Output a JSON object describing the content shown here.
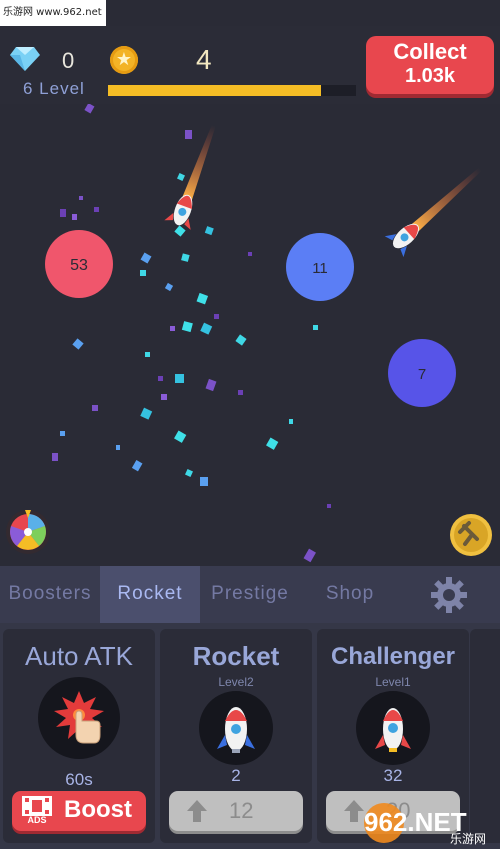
{
  "watermark_top": "乐游网 www.962.net",
  "hud": {
    "gems": "0",
    "coins": "4",
    "coin_symbol": "★",
    "level": "6 Level",
    "level_progress": 0.86,
    "collect_label": "Collect",
    "collect_amount": "1.03k"
  },
  "field": {
    "targets": [
      {
        "label": "53",
        "color": "#f0566c"
      },
      {
        "label": "11",
        "color": "#5b7ef5"
      },
      {
        "label": "7",
        "color": "#5754e8"
      }
    ]
  },
  "tabs": [
    {
      "label": "Boosters"
    },
    {
      "label": "Rocket"
    },
    {
      "label": "Prestige"
    },
    {
      "label": "Shop"
    }
  ],
  "cards": {
    "auto_atk": {
      "title": "Auto ATK",
      "value": "60s",
      "ads_label": "ADS",
      "button_label": "Boost"
    },
    "rocket": {
      "title": "Rocket",
      "level": "Level2",
      "value": "2",
      "cost": "12"
    },
    "challenger": {
      "title": "Challenger",
      "level": "Level1",
      "value": "32",
      "cost": "20"
    }
  },
  "watermark_bottom": {
    "brand": "962.NET",
    "sub": "乐游网"
  }
}
